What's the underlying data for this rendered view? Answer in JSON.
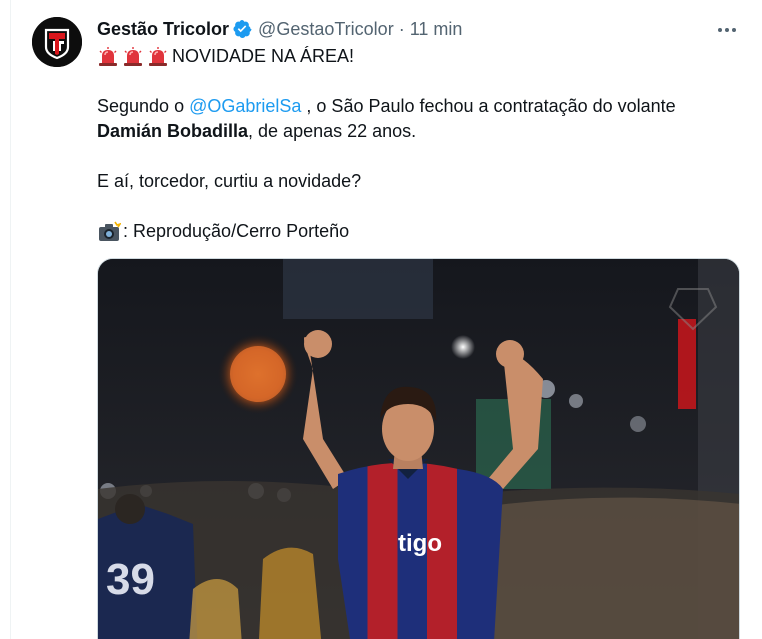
{
  "tweet": {
    "display_name": "Gestão Tricolor",
    "handle": "@GestaoTricolor",
    "separator": "·",
    "time": "11 min",
    "headline": "NOVIDADE NA ÁREA!",
    "para1_prefix": "Segundo o ",
    "mention": "@OGabrielSa",
    "para1_suffix": " , o São Paulo fechou a contratação do volante",
    "player_name": "Damián Bobadilla",
    "para1_end": ", de apenas 22 anos.",
    "question": "E aí, torcedor, curtiu a novidade?",
    "credit": ": Reprodução/Cerro Porteño"
  },
  "media": {
    "jersey_text": "tigo",
    "back_number": "39"
  },
  "icons": {
    "avatar": "gestao-tricolor-logo",
    "verified": "verified-badge-icon",
    "siren": "police-light-emoji",
    "camera": "camera-flash-emoji",
    "more": "more-options-icon"
  },
  "colors": {
    "link": "#1d9bf0",
    "verified": "#1d9bf0",
    "secondary_text": "#536471",
    "text": "#0f1419"
  }
}
